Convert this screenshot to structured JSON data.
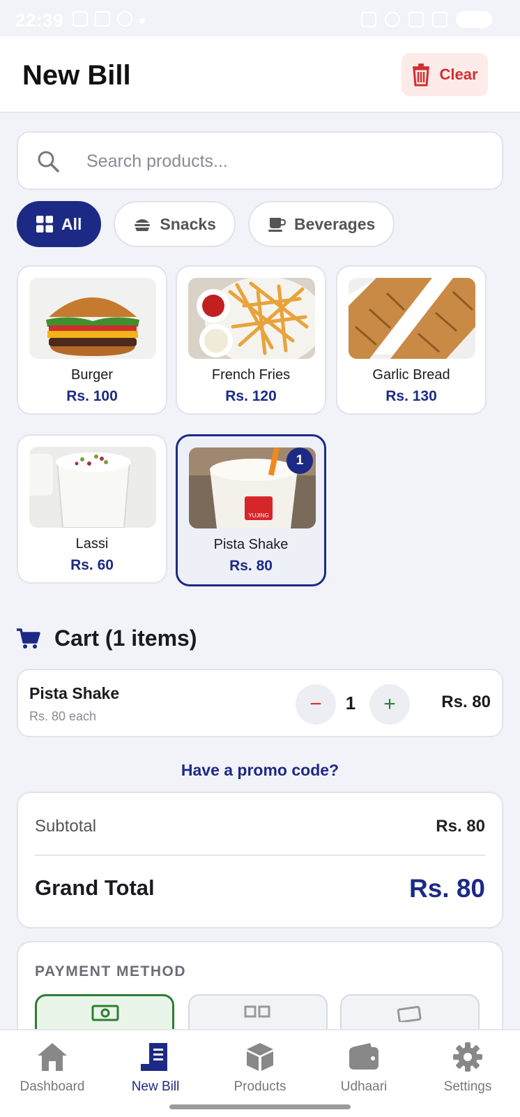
{
  "status_bar": {
    "time": "22:39"
  },
  "header": {
    "title": "New Bill",
    "clear_label": "Clear"
  },
  "search": {
    "placeholder": "Search products..."
  },
  "categories": [
    {
      "label": "All",
      "icon": "grid-icon",
      "active": true
    },
    {
      "label": "Snacks",
      "icon": "burger-icon",
      "active": false
    },
    {
      "label": "Beverages",
      "icon": "cup-icon",
      "active": false
    }
  ],
  "products": [
    {
      "name": "Burger",
      "price": "Rs. 100",
      "image": "burger-image"
    },
    {
      "name": "French Fries",
      "price": "Rs. 120",
      "image": "fries-image"
    },
    {
      "name": "Garlic Bread",
      "price": "Rs. 130",
      "image": "garlic-bread-image"
    },
    {
      "name": "Lassi",
      "price": "Rs. 60",
      "image": "lassi-image"
    },
    {
      "name": "Pista Shake",
      "price": "Rs. 80",
      "image": "shake-image",
      "selected": true,
      "badge": "1"
    }
  ],
  "cart": {
    "title": "Cart (1 items)",
    "items": [
      {
        "name": "Pista Shake",
        "each": "Rs. 80 each",
        "qty": "1",
        "total": "Rs. 80"
      }
    ],
    "minus": "−",
    "plus": "+"
  },
  "promo_label": "Have a promo code?",
  "totals": {
    "subtotal_label": "Subtotal",
    "subtotal_value": "Rs. 80",
    "grand_total_label": "Grand Total",
    "grand_total_value": "Rs. 80"
  },
  "payment": {
    "title": "PAYMENT METHOD"
  },
  "nav": [
    {
      "label": "Dashboard",
      "icon": "home-icon",
      "active": false
    },
    {
      "label": "New Bill",
      "icon": "receipt-icon",
      "active": true
    },
    {
      "label": "Products",
      "icon": "box-icon",
      "active": false
    },
    {
      "label": "Udhaari",
      "icon": "wallet-icon",
      "active": false
    },
    {
      "label": "Settings",
      "icon": "gear-icon",
      "active": false
    }
  ],
  "colors": {
    "primary": "#1c2a86",
    "danger": "#d32f2f",
    "success": "#2e7d32",
    "background": "#f2f3f8"
  }
}
